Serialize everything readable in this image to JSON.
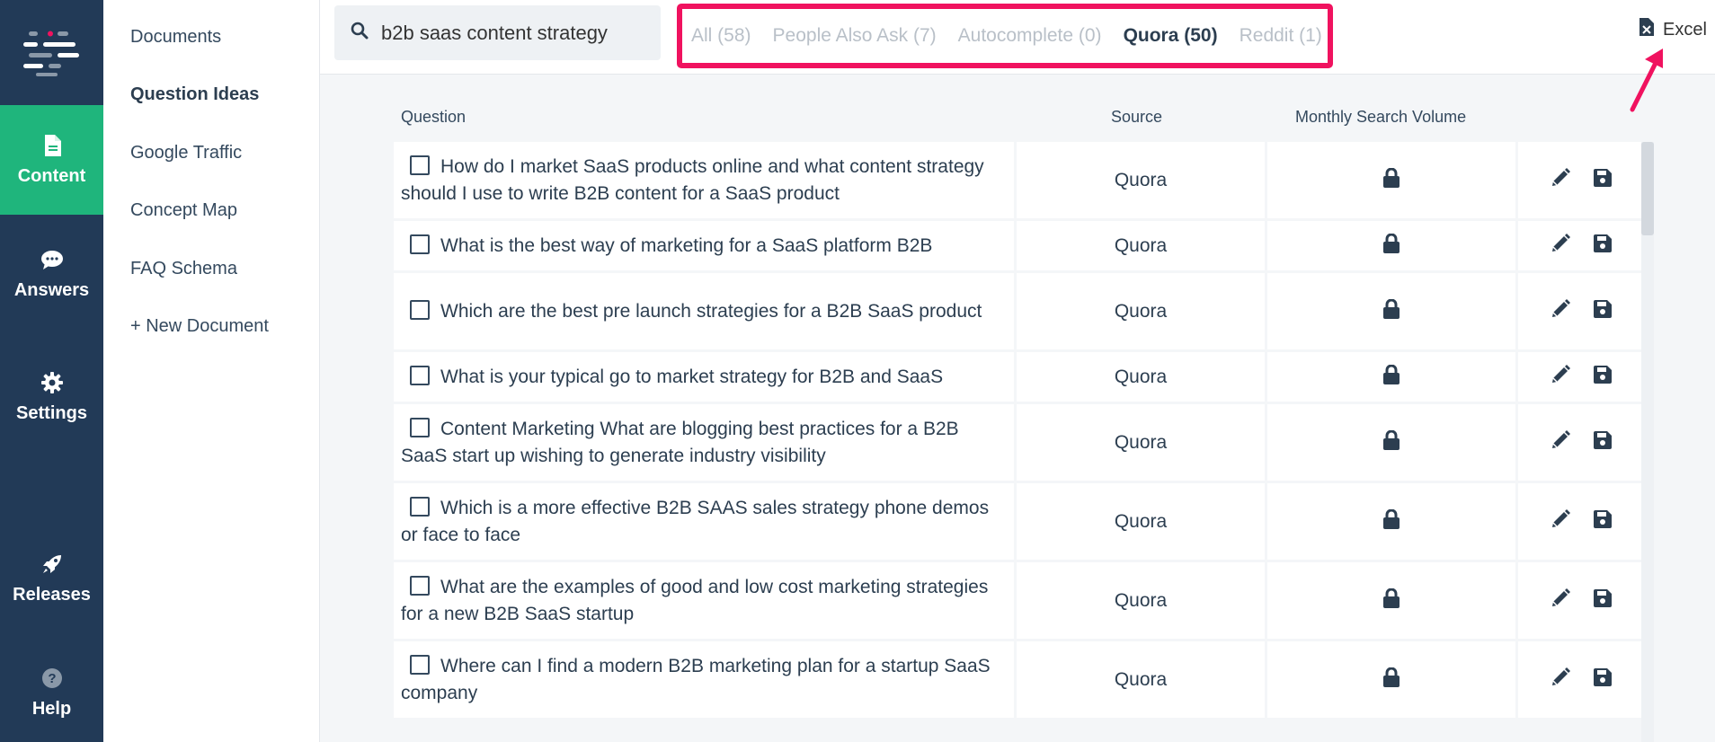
{
  "rail": {
    "items": [
      {
        "label": "Content",
        "icon": "document-icon"
      },
      {
        "label": "Answers",
        "icon": "chat-bubble-icon"
      },
      {
        "label": "Settings",
        "icon": "gear-icon"
      },
      {
        "label": "Releases",
        "icon": "rocket-icon"
      },
      {
        "label": "Help",
        "icon": "question-circle-icon"
      }
    ],
    "active_color": "#1fb57c",
    "background": "#223a57"
  },
  "subnav": {
    "items": [
      {
        "label": "Documents"
      },
      {
        "label": "Question Ideas"
      },
      {
        "label": "Google Traffic"
      },
      {
        "label": "Concept Map"
      },
      {
        "label": "FAQ Schema"
      },
      {
        "label": "+ New Document"
      }
    ]
  },
  "search": {
    "value": "b2b saas content strategy"
  },
  "filters": [
    {
      "label": "All (58)"
    },
    {
      "label": "People Also Ask (7)"
    },
    {
      "label": "Autocomplete (0)"
    },
    {
      "label": "Quora (50)"
    },
    {
      "label": "Reddit (1)"
    }
  ],
  "highlight_color": "#f0125f",
  "export": {
    "label": "Excel"
  },
  "table": {
    "headers": {
      "question": "Question",
      "source": "Source",
      "volume": "Monthly Search Volume"
    },
    "rows": [
      {
        "question": "How do I market SaaS products online and what content strategy should I use to write B2B content for a SaaS product",
        "source": "Quora"
      },
      {
        "question": "What is the best way of marketing for a SaaS platform B2B",
        "source": "Quora"
      },
      {
        "question": "Which are the best pre launch strategies for a B2B SaaS product",
        "source": "Quora"
      },
      {
        "question": "What is your typical go to market strategy for B2B and SaaS",
        "source": "Quora"
      },
      {
        "question": "Content Marketing What are blogging best practices for a B2B SaaS start up wishing to generate industry visibility",
        "source": "Quora"
      },
      {
        "question": "Which is a more effective B2B SAAS sales strategy phone demos or face to face",
        "source": "Quora"
      },
      {
        "question": "What are the examples of good and low cost marketing strategies for a new B2B SaaS startup",
        "source": "Quora"
      },
      {
        "question": "Where can I find a modern B2B marketing plan for a startup SaaS company",
        "source": "Quora"
      }
    ]
  }
}
